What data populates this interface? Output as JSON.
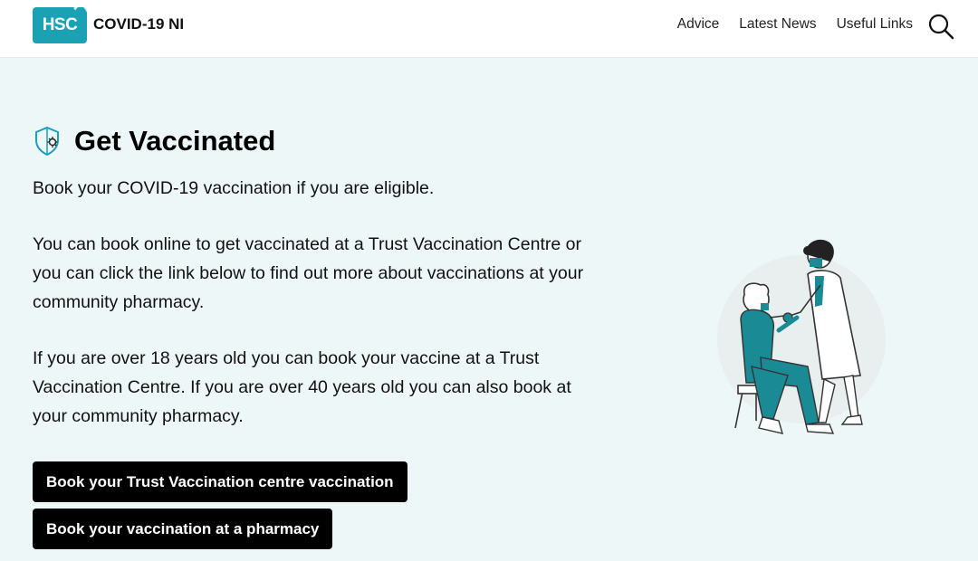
{
  "header": {
    "logo_text": "HSC",
    "site_title": "COVID-19 NI",
    "nav": [
      {
        "label": "Advice"
      },
      {
        "label": "Latest News"
      },
      {
        "label": "Useful Links"
      }
    ],
    "search_icon": "search-icon"
  },
  "main": {
    "icon": "shield-virus-icon",
    "title": "Get Vaccinated",
    "paragraphs": [
      "Book your COVID-19 vaccination if you are eligible.",
      "You can book online to get vaccinated at a Trust Vaccination Centre or you can click the link below to find out more about vaccinations at your community pharmacy.",
      "If you are over 18 years old you can book your vaccine at a Trust Vaccination Centre.  If you are over 40 years old you can also book at your community pharmacy."
    ],
    "buttons": [
      {
        "label": "Book your Trust Vaccination centre vaccination"
      },
      {
        "label": "Book your vaccination at a pharmacy"
      }
    ]
  },
  "colors": {
    "brand_teal": "#1aa1b3",
    "page_bg": "#eef7f8",
    "button_bg": "#000000"
  }
}
